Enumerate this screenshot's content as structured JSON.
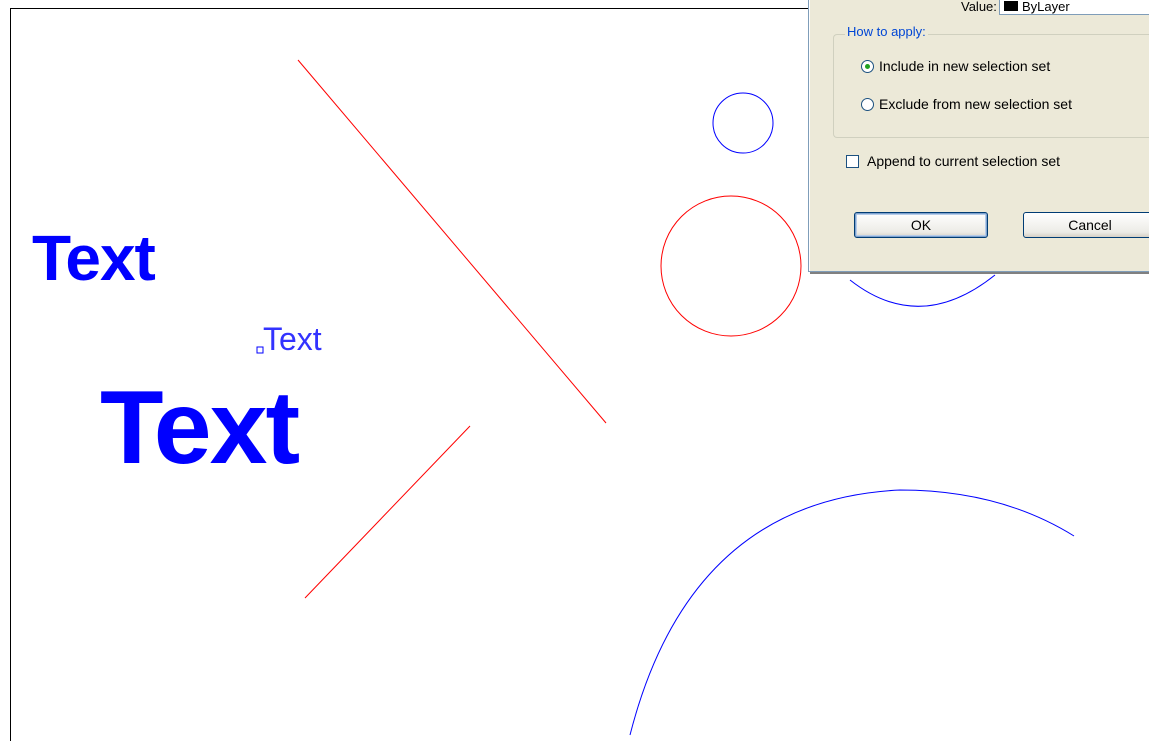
{
  "drawing": {
    "texts": [
      "Text",
      "Text",
      "Text"
    ],
    "colors": {
      "line_red": "#FF0000",
      "circle_blue": "#0000FF",
      "text_blue": "#0000FF"
    }
  },
  "dialog": {
    "property_label": "Value:",
    "property_value": "ByLayer",
    "how_to_apply_title": "How to apply:",
    "options": [
      {
        "label": "Include in new selection set",
        "selected": true
      },
      {
        "label": "Exclude from new selection set",
        "selected": false
      }
    ],
    "append_label": "Append to current selection set",
    "append_checked": false,
    "ok_label": "OK",
    "cancel_label": "Cancel"
  }
}
